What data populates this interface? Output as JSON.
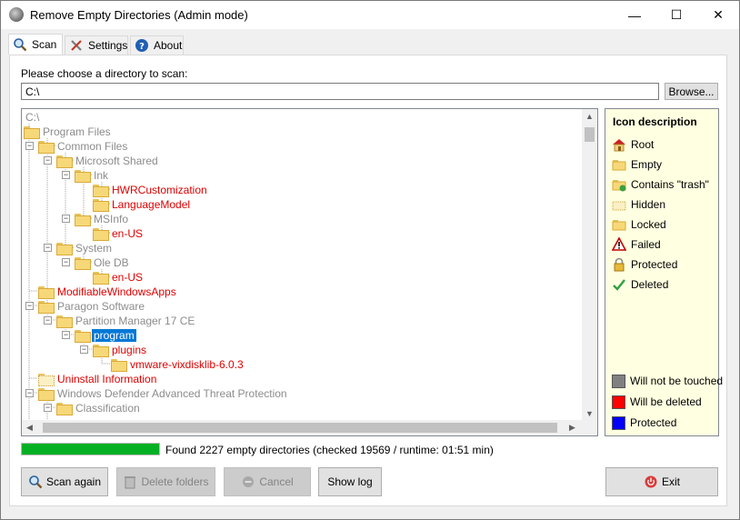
{
  "window": {
    "title": "Remove Empty Directories (Admin mode)",
    "controls": {
      "minimize": "—",
      "maximize": "☐",
      "close": "✕"
    }
  },
  "tabs": [
    {
      "label": "Scan",
      "icon": "magnifier-icon",
      "active": true
    },
    {
      "label": "Settings",
      "icon": "tools-icon",
      "active": false
    },
    {
      "label": "About",
      "icon": "help-icon",
      "active": false
    }
  ],
  "scan": {
    "choose_label": "Please choose a directory to scan:",
    "path_value": "C:\\",
    "browse_label": "Browse..."
  },
  "tree": {
    "nodes": [
      {
        "label": "C:\\",
        "color": "grey",
        "folder": "none"
      },
      {
        "label": "Program Files",
        "color": "grey",
        "folder": "normal"
      },
      {
        "label": "Common Files",
        "color": "grey",
        "folder": "normal"
      },
      {
        "label": "Microsoft Shared",
        "color": "grey",
        "folder": "normal"
      },
      {
        "label": "Ink",
        "color": "grey",
        "folder": "normal"
      },
      {
        "label": "HWRCustomization",
        "color": "red",
        "folder": "normal"
      },
      {
        "label": "LanguageModel",
        "color": "red",
        "folder": "normal"
      },
      {
        "label": "MSInfo",
        "color": "grey",
        "folder": "normal"
      },
      {
        "label": "en-US",
        "color": "red",
        "folder": "normal"
      },
      {
        "label": "System",
        "color": "grey",
        "folder": "normal"
      },
      {
        "label": "Ole DB",
        "color": "grey",
        "folder": "normal"
      },
      {
        "label": "en-US",
        "color": "red",
        "folder": "normal"
      },
      {
        "label": "ModifiableWindowsApps",
        "color": "red",
        "folder": "normal"
      },
      {
        "label": "Paragon Software",
        "color": "grey",
        "folder": "normal"
      },
      {
        "label": "Partition Manager 17 CE",
        "color": "grey",
        "folder": "normal"
      },
      {
        "label": "program",
        "color": "selected",
        "folder": "normal"
      },
      {
        "label": "plugins",
        "color": "red",
        "folder": "normal"
      },
      {
        "label": "vmware-vixdisklib-6.0.3",
        "color": "red",
        "folder": "normal"
      },
      {
        "label": "Uninstall Information",
        "color": "red",
        "folder": "dotted"
      },
      {
        "label": "Windows Defender Advanced Threat Protection",
        "color": "grey",
        "folder": "normal"
      },
      {
        "label": "Classification",
        "color": "grey",
        "folder": "normal"
      }
    ]
  },
  "legend": {
    "title": "Icon description",
    "icons": [
      {
        "label": "Root",
        "icon": "root-house-icon"
      },
      {
        "label": "Empty",
        "icon": "empty-folder-icon"
      },
      {
        "label": "Contains \"trash\"",
        "icon": "trash-folder-icon"
      },
      {
        "label": "Hidden",
        "icon": "hidden-folder-icon"
      },
      {
        "label": "Locked",
        "icon": "locked-folder-icon"
      },
      {
        "label": "Failed",
        "icon": "warning-icon"
      },
      {
        "label": "Protected",
        "icon": "padlock-icon"
      },
      {
        "label": "Deleted",
        "icon": "checkmark-icon"
      }
    ],
    "colors": [
      {
        "label": "Will not be touched",
        "color": "#808080"
      },
      {
        "label": "Will be deleted",
        "color": "#ff0000"
      },
      {
        "label": "Protected",
        "color": "#0000ff"
      }
    ]
  },
  "progress": {
    "fraction": 1.0,
    "color": "#06b025"
  },
  "status_text": "Found 2227 empty directories (checked 19569 / runtime: 01:51 min)",
  "buttons": {
    "scan_again": "Scan again",
    "delete_folders": "Delete folders",
    "cancel": "Cancel",
    "show_log": "Show log",
    "exit": "Exit"
  }
}
